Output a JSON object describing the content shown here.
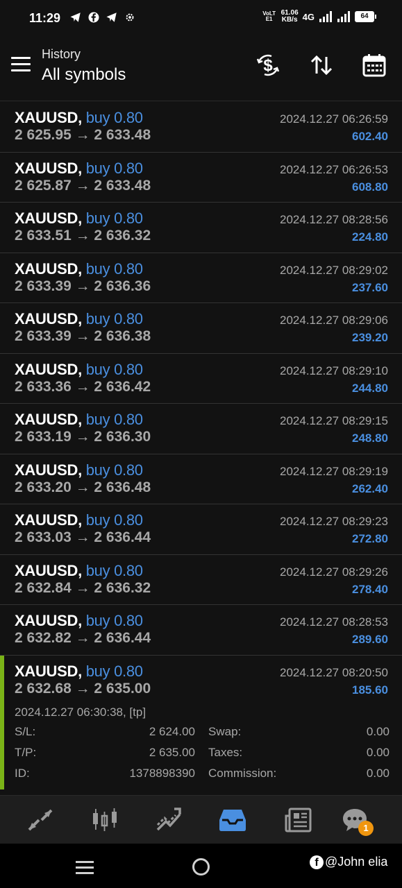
{
  "status_bar": {
    "time": "11:29",
    "volte": "VoLTE1",
    "speed_value": "61.06",
    "speed_unit": "KB/s",
    "network": "4G",
    "battery": "64"
  },
  "header": {
    "subtitle": "History",
    "title": "All symbols"
  },
  "deals": [
    {
      "symbol": "XAUUSD",
      "side": "buy 0.80",
      "open": "2 625.95",
      "close": "2 633.48",
      "time": "2024.12.27 06:26:59",
      "profit": "602.40"
    },
    {
      "symbol": "XAUUSD",
      "side": "buy 0.80",
      "open": "2 625.87",
      "close": "2 633.48",
      "time": "2024.12.27 06:26:53",
      "profit": "608.80"
    },
    {
      "symbol": "XAUUSD",
      "side": "buy 0.80",
      "open": "2 633.51",
      "close": "2 636.32",
      "time": "2024.12.27 08:28:56",
      "profit": "224.80"
    },
    {
      "symbol": "XAUUSD",
      "side": "buy 0.80",
      "open": "2 633.39",
      "close": "2 636.36",
      "time": "2024.12.27 08:29:02",
      "profit": "237.60"
    },
    {
      "symbol": "XAUUSD",
      "side": "buy 0.80",
      "open": "2 633.39",
      "close": "2 636.38",
      "time": "2024.12.27 08:29:06",
      "profit": "239.20"
    },
    {
      "symbol": "XAUUSD",
      "side": "buy 0.80",
      "open": "2 633.36",
      "close": "2 636.42",
      "time": "2024.12.27 08:29:10",
      "profit": "244.80"
    },
    {
      "symbol": "XAUUSD",
      "side": "buy 0.80",
      "open": "2 633.19",
      "close": "2 636.30",
      "time": "2024.12.27 08:29:15",
      "profit": "248.80"
    },
    {
      "symbol": "XAUUSD",
      "side": "buy 0.80",
      "open": "2 633.20",
      "close": "2 636.48",
      "time": "2024.12.27 08:29:19",
      "profit": "262.40"
    },
    {
      "symbol": "XAUUSD",
      "side": "buy 0.80",
      "open": "2 633.03",
      "close": "2 636.44",
      "time": "2024.12.27 08:29:23",
      "profit": "272.80"
    },
    {
      "symbol": "XAUUSD",
      "side": "buy 0.80",
      "open": "2 632.84",
      "close": "2 636.32",
      "time": "2024.12.27 08:29:26",
      "profit": "278.40"
    },
    {
      "symbol": "XAUUSD",
      "side": "buy 0.80",
      "open": "2 632.82",
      "close": "2 636.44",
      "time": "2024.12.27 08:28:53",
      "profit": "289.60"
    }
  ],
  "expanded_deal": {
    "symbol": "XAUUSD",
    "side": "buy 0.80",
    "open": "2 632.68",
    "close": "2 635.00",
    "time": "2024.12.27 08:20:50",
    "profit": "185.60",
    "close_time": "2024.12.27 06:30:38, [tp]",
    "sl_label": "S/L:",
    "sl_value": "2 624.00",
    "tp_label": "T/P:",
    "tp_value": "2 635.00",
    "id_label": "ID:",
    "id_value": "1378898390",
    "swap_label": "Swap:",
    "swap_value": "0.00",
    "taxes_label": "Taxes:",
    "taxes_value": "0.00",
    "commission_label": "Commission:",
    "commission_value": "0.00"
  },
  "bottom_nav": {
    "items": [
      "quotes-icon",
      "chart-icon",
      "trade-icon",
      "history-icon",
      "news-icon",
      "chat-icon"
    ],
    "active": "history-icon",
    "chat_badge": "1"
  },
  "watermark": "@John elia",
  "colors": {
    "accent": "#4a8fe0",
    "expanded_marker": "#7ab317",
    "badge": "#f0960f"
  }
}
